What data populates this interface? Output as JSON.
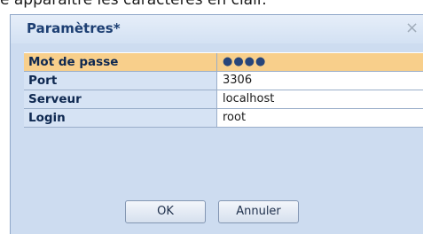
{
  "background": {
    "text": "e apparaître les caractères en clair."
  },
  "dialog": {
    "title": "Paramètres*",
    "close_symbol": "×",
    "properties": [
      {
        "key": "Mot de passe",
        "value": "●●●●",
        "selected": true
      },
      {
        "key": "Port",
        "value": "3306",
        "selected": false
      },
      {
        "key": "Serveur",
        "value": "localhost",
        "selected": false
      },
      {
        "key": "Login",
        "value": "root",
        "selected": false
      }
    ],
    "buttons": {
      "ok_label": "OK",
      "cancel_label": "Annuler"
    }
  }
}
